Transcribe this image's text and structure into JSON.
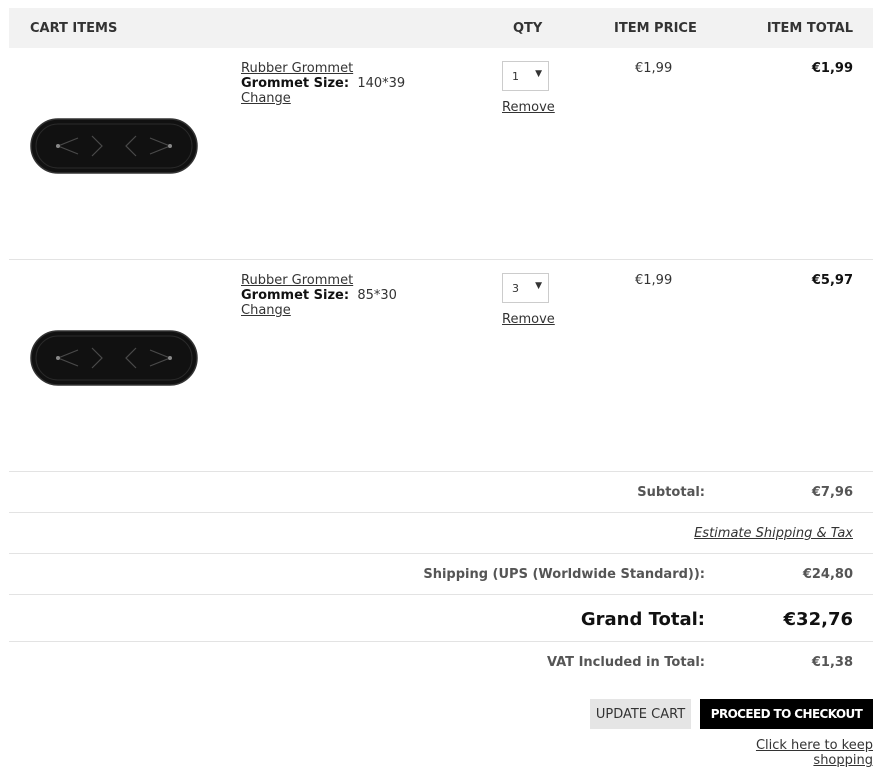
{
  "header": {
    "items": "CART ITEMS",
    "qty": "QTY",
    "price": "ITEM PRICE",
    "total": "ITEM TOTAL"
  },
  "items": [
    {
      "name": "Rubber Grommet",
      "option_label": "Grommet Size:",
      "option_value": "140*39",
      "change": "Change",
      "qty": "1",
      "remove": "Remove",
      "price": "€1,99",
      "total": "€1,99"
    },
    {
      "name": "Rubber Grommet",
      "option_label": "Grommet Size:",
      "option_value": "85*30",
      "change": "Change",
      "qty": "3",
      "remove": "Remove",
      "price": "€1,99",
      "total": "€5,97"
    }
  ],
  "totals": {
    "subtotal_label": "Subtotal:",
    "subtotal": "€7,96",
    "estimate_link": "Estimate Shipping & Tax",
    "shipping_label": "Shipping (UPS (Worldwide Standard)):",
    "shipping": "€24,80",
    "grand_label": "Grand Total:",
    "grand": "€32,76",
    "vat_label": "VAT Included in Total:",
    "vat": "€1,38"
  },
  "actions": {
    "update": "UPDATE CART",
    "checkout": "PROCEED TO CHECKOUT",
    "keep_shopping": "Click here to keep shopping"
  },
  "icons": {
    "dropdown": "caret-down-icon"
  }
}
